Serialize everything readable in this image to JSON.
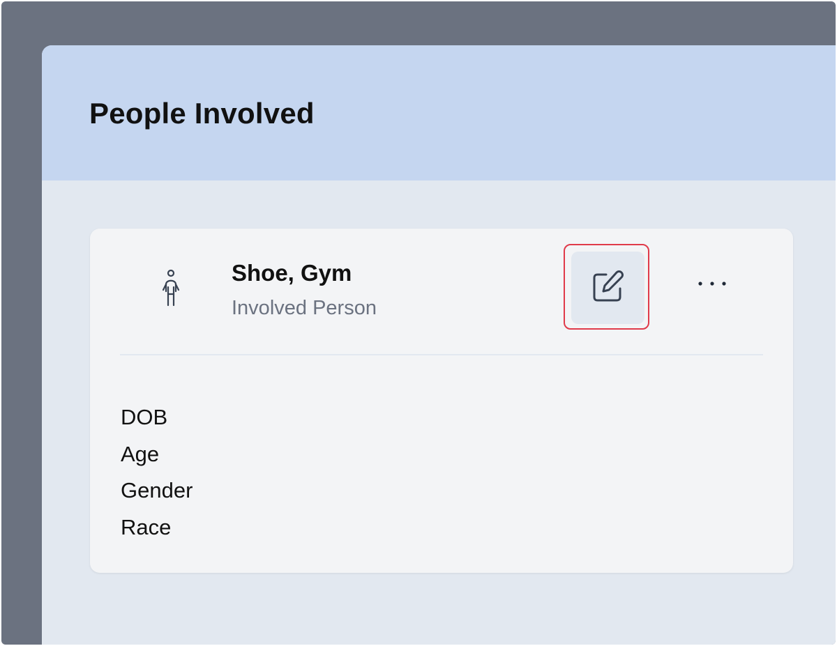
{
  "section": {
    "title": "People Involved"
  },
  "person_card": {
    "icon": "person-icon",
    "name": "Shoe, Gym",
    "role": "Involved Person",
    "edit_icon": "edit-icon",
    "more_icon": "more-horizontal-icon",
    "fields": [
      {
        "label": "DOB"
      },
      {
        "label": "Age"
      },
      {
        "label": "Gender"
      },
      {
        "label": "Race"
      }
    ]
  },
  "colors": {
    "header_bg": "#c5d6f0",
    "panel_bg": "#e2e8f0",
    "card_bg": "#f3f4f6",
    "highlight": "#e03a4a",
    "backdrop": "#6b7280"
  }
}
